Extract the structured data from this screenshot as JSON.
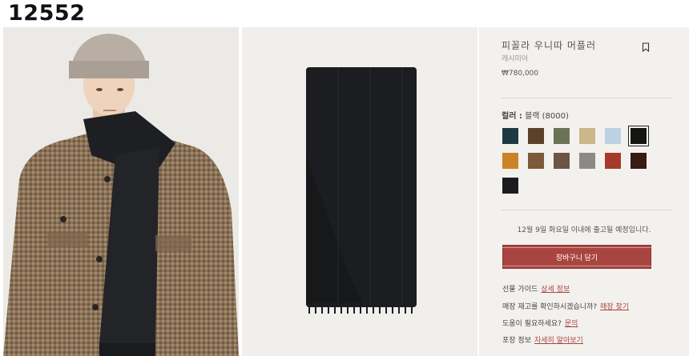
{
  "header": {
    "id_label": "12552"
  },
  "product": {
    "title": "피꼴라 우니따 머플러",
    "subtitle": "캐시미어",
    "price": "₩780,000",
    "color_label_prefix": "컬러 :",
    "color_label_value": "블랙 (8000)",
    "swatches": [
      {
        "name": "dark-teal",
        "color": "#1d3a44"
      },
      {
        "name": "brown",
        "color": "#5b4128"
      },
      {
        "name": "olive",
        "color": "#6b7256"
      },
      {
        "name": "sand",
        "color": "#cdb68a"
      },
      {
        "name": "light-blue",
        "color": "#bcd1e3"
      },
      {
        "name": "black",
        "color": "#151515",
        "selected": true
      },
      {
        "name": "ochre",
        "color": "#cc8227"
      },
      {
        "name": "camel",
        "color": "#7a5a3a"
      },
      {
        "name": "mocha",
        "color": "#6e5444"
      },
      {
        "name": "grey",
        "color": "#8d8a86"
      },
      {
        "name": "red",
        "color": "#a63a2a"
      },
      {
        "name": "dark-burgundy",
        "color": "#3a1a14"
      },
      {
        "name": "charcoal",
        "color": "#1b1c20"
      }
    ],
    "shipping_note": "12월 9일 화요일 이내에 출고될 예정입니다.",
    "cart_button": "장바구니 담기",
    "info": [
      {
        "label": "선물 가이드",
        "link": "상세 정보"
      },
      {
        "label": "매장 재고를 확인하시겠습니까?",
        "link": "매장 찾기"
      },
      {
        "label": "도움이 필요하세요?",
        "link": "문의"
      },
      {
        "label": "포장 정보",
        "link": "자세히 알아보기"
      }
    ]
  },
  "colors": {
    "accent": "#a94540",
    "panel_bg": "#f3f1ed"
  },
  "icons": {
    "bookmark": "bookmark-icon"
  }
}
